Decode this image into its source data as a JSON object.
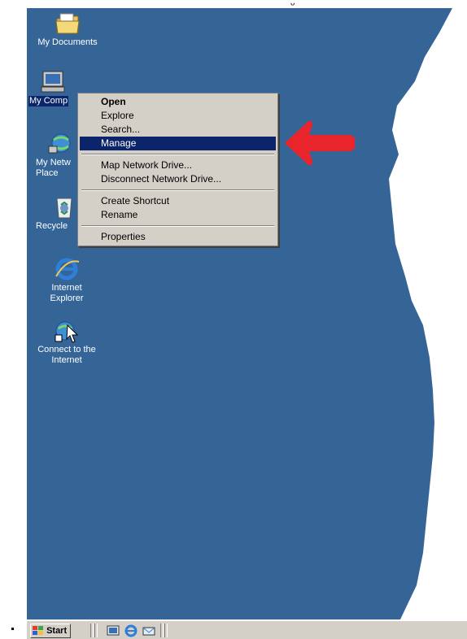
{
  "colors": {
    "desktop_blue": "#356597",
    "menu_bg": "#d4d0c8",
    "highlight": "#0b246a",
    "arrow": "#e8252b"
  },
  "desktop": {
    "icons": [
      {
        "label": "My Documents",
        "icon": "folder-icon"
      },
      {
        "label": "My Comp",
        "icon": "computer-icon"
      },
      {
        "label": "My Netw Place",
        "icon": "network-icon"
      },
      {
        "label": "Recycle",
        "icon": "recycle-bin-icon"
      },
      {
        "label": "Internet Explorer",
        "icon": "internet-explorer-icon"
      },
      {
        "label": "Connect to the Internet",
        "icon": "connect-icon"
      }
    ]
  },
  "context_menu": {
    "items": {
      "open": "Open",
      "explore": "Explore",
      "search": "Search...",
      "manage": "Manage",
      "map_drive": "Map Network Drive...",
      "disconnect_drive": "Disconnect Network Drive...",
      "create_shortcut": "Create Shortcut",
      "rename": "Rename",
      "properties": "Properties"
    },
    "highlighted": "Manage"
  },
  "taskbar": {
    "start_label": "Start",
    "quick_launch": [
      "show-desktop-icon",
      "internet-explorer-icon",
      "outlook-icon"
    ]
  }
}
